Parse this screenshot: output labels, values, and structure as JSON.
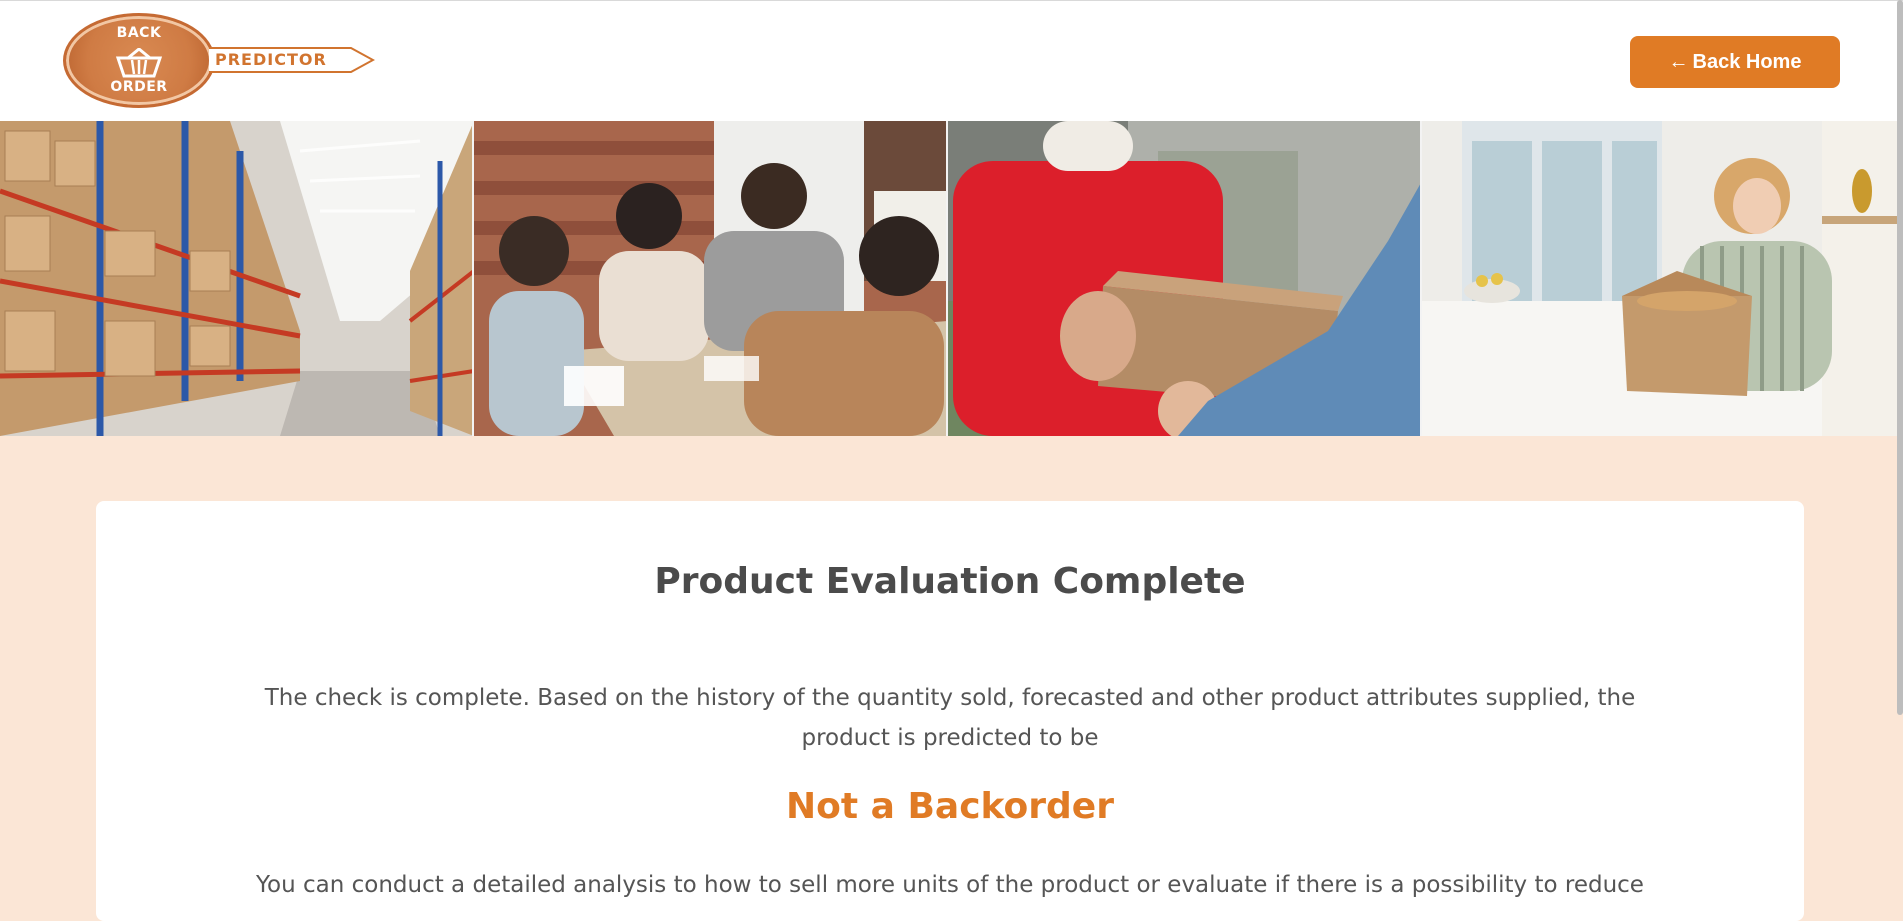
{
  "header": {
    "logo": {
      "seal_top": "BACK",
      "seal_bottom": "ORDER",
      "arrow_label": "PREDICTOR"
    },
    "back_button": {
      "arrow": "←",
      "label": "Back Home"
    }
  },
  "banner": {
    "images": [
      {
        "name": "warehouse-image"
      },
      {
        "name": "team-meeting-image"
      },
      {
        "name": "delivery-image"
      },
      {
        "name": "unboxing-image"
      }
    ]
  },
  "card": {
    "title": "Product Evaluation Complete",
    "text": "The check is complete. Based on the history of the quantity sold, forecasted and other product attributes supplied, the product is predicted to be",
    "result": "Not a Backorder",
    "text2": "You can conduct a detailed analysis to how to sell more units of the product or evaluate if there is a possibility to reduce"
  },
  "colors": {
    "accent": "#e07b25",
    "background": "#fbe6d6",
    "text": "#555555"
  }
}
